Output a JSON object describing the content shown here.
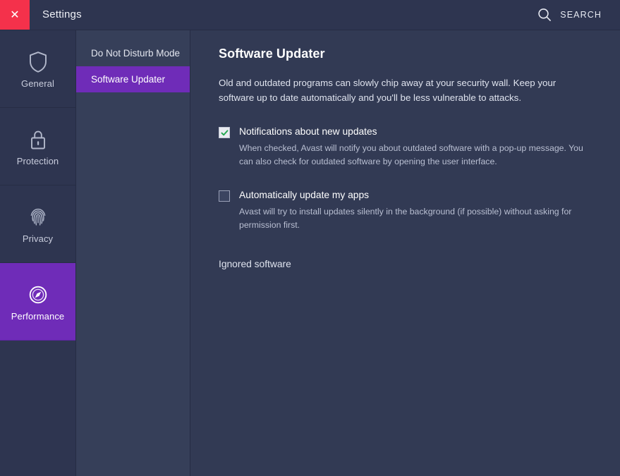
{
  "window": {
    "title": "Settings",
    "close_icon": "close-x-icon",
    "close_color": "#f4314b"
  },
  "search": {
    "label": "SEARCH",
    "icon": "search-icon"
  },
  "sidebar": {
    "items": [
      {
        "label": "General",
        "icon": "shield-icon",
        "active": false
      },
      {
        "label": "Protection",
        "icon": "lock-icon",
        "active": false
      },
      {
        "label": "Privacy",
        "icon": "fingerprint-icon",
        "active": false
      },
      {
        "label": "Performance",
        "icon": "speedometer-icon",
        "active": true
      }
    ],
    "active_color": "#6f2cb8"
  },
  "subnav": {
    "items": [
      {
        "label": "Do Not Disturb Mode",
        "active": false
      },
      {
        "label": "Software Updater",
        "active": true
      }
    ]
  },
  "main": {
    "title": "Software Updater",
    "description": "Old and outdated programs can slowly chip away at your security wall. Keep your software up to date automatically and you'll be less vulnerable to attacks.",
    "options": [
      {
        "label": "Notifications about new updates",
        "help": "When checked, Avast will notify you about outdated software with a pop-up message. You can also check for outdated software by opening the user interface.",
        "checked": true,
        "check_color": "#22a74f"
      },
      {
        "label": "Automatically update my apps",
        "help": "Avast will try to install updates silently in the background (if possible) without asking for permission first.",
        "checked": false,
        "check_color": "#22a74f"
      }
    ],
    "ignored_software_link": "Ignored software"
  }
}
